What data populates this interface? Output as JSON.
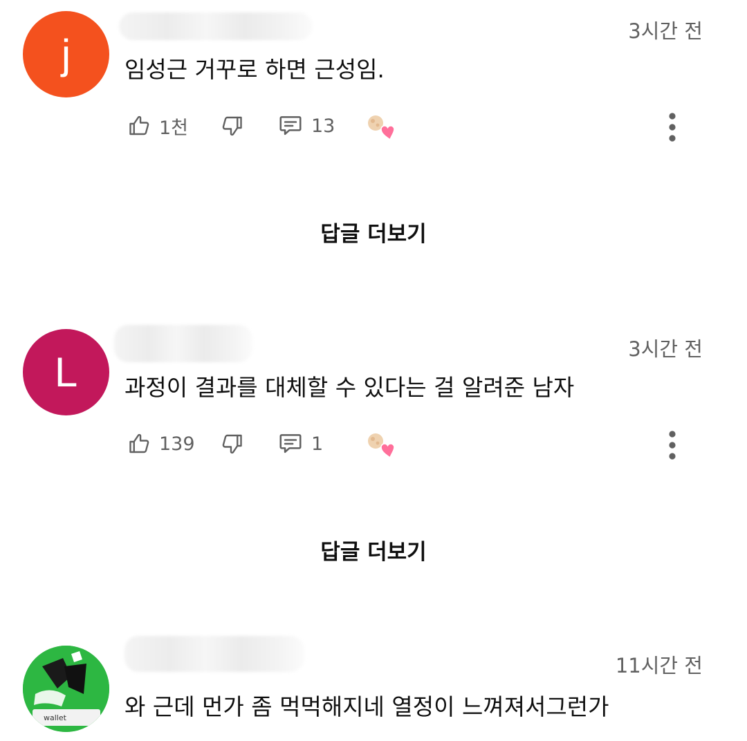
{
  "comments": [
    {
      "avatar_letter": "j",
      "avatar_color": "#f4511e",
      "timestamp": "3시간 전",
      "text": "임성근 거꾸로 하면 근성임.",
      "likes": "1천",
      "replies": "13",
      "more_replies_label": "답글 더보기"
    },
    {
      "avatar_letter": "L",
      "avatar_color": "#c2185b",
      "timestamp": "3시간 전",
      "text": "과정이 결과를 대체할 수 있다는 걸 알려준 남자",
      "likes": "139",
      "replies": "1",
      "more_replies_label": "답글 더보기"
    },
    {
      "avatar_image_text": "wallet",
      "timestamp": "11시간 전",
      "text": "와 근데 먼가 좀 먹먹해지네 열정이 느껴져서그런가"
    }
  ],
  "icons": {
    "like": "thumbs-up-icon",
    "dislike": "thumbs-down-icon",
    "reply": "comment-icon",
    "creator_heart": "creator-heart-icon",
    "more": "more-vertical-icon"
  }
}
